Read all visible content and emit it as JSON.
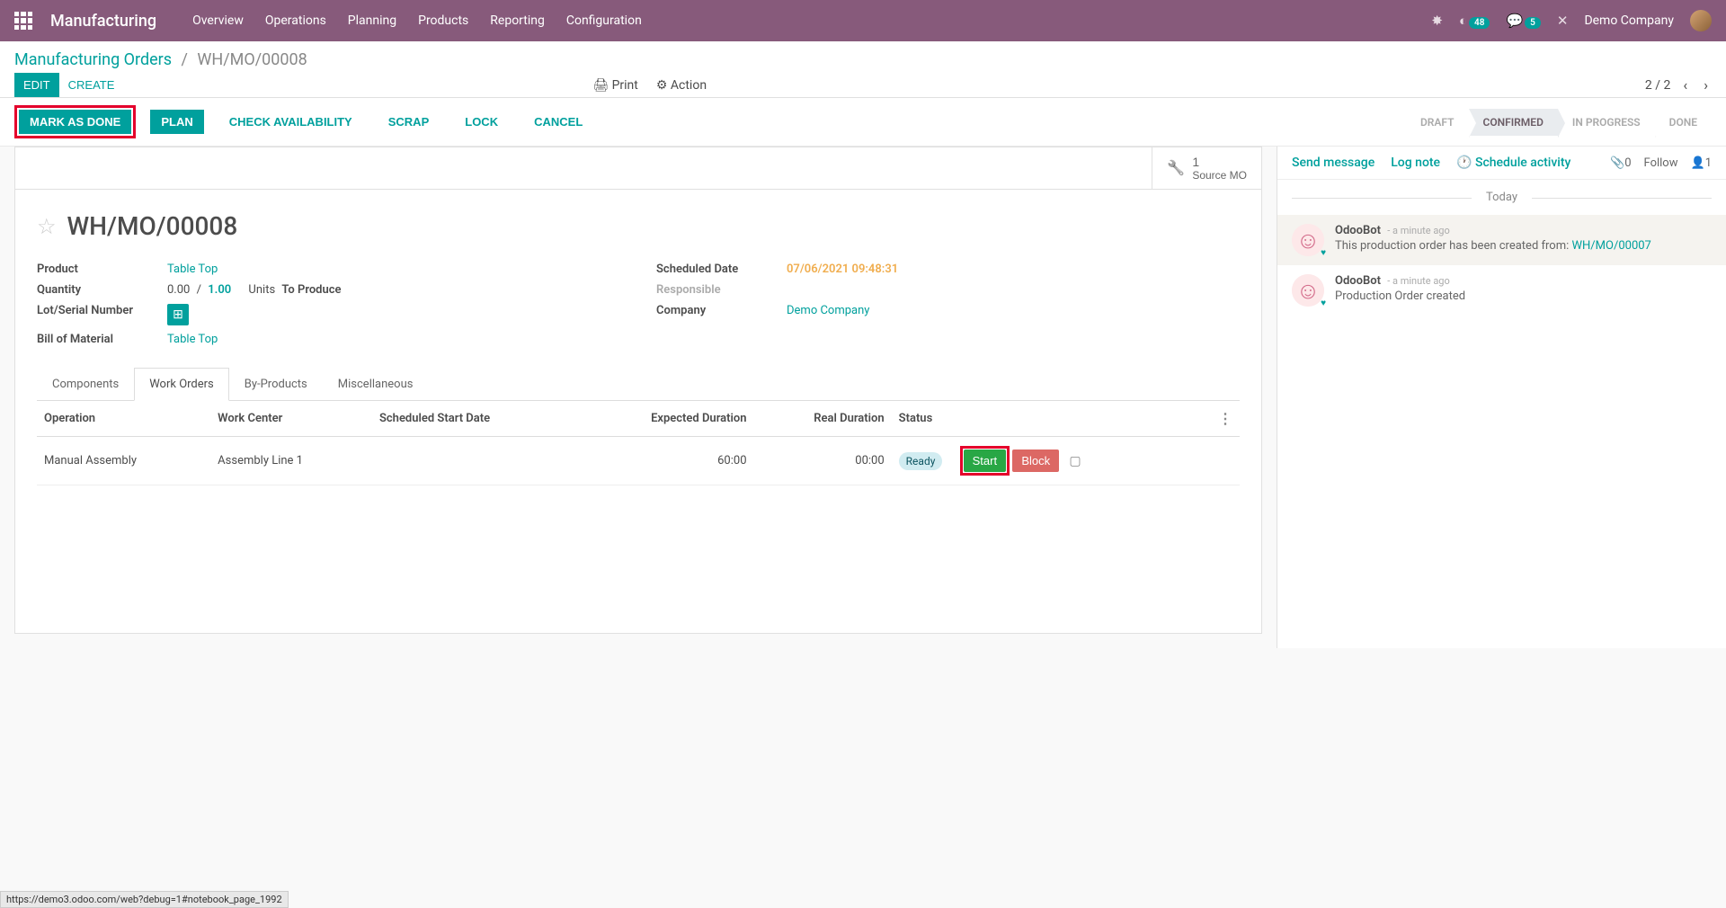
{
  "topnav": {
    "app_title": "Manufacturing",
    "menu": [
      "Overview",
      "Operations",
      "Planning",
      "Products",
      "Reporting",
      "Configuration"
    ],
    "badge1": "48",
    "badge2": "5",
    "company": "Demo Company"
  },
  "breadcrumb": {
    "root": "Manufacturing Orders",
    "current": "WH/MO/00008"
  },
  "head_buttons": {
    "edit": "EDIT",
    "create": "CREATE"
  },
  "head_actions": {
    "print": "Print",
    "action": "Action"
  },
  "pager": {
    "text": "2 / 2"
  },
  "action_buttons": {
    "mark_done": "MARK AS DONE",
    "plan": "PLAN",
    "check_avail": "CHECK AVAILABILITY",
    "scrap": "SCRAP",
    "lock": "LOCK",
    "cancel": "CANCEL"
  },
  "status_steps": [
    "DRAFT",
    "CONFIRMED",
    "IN PROGRESS",
    "DONE"
  ],
  "active_status": "CONFIRMED",
  "stat_button": {
    "count": "1",
    "label": "Source MO"
  },
  "record": {
    "name": "WH/MO/00008",
    "product_label": "Product",
    "product": "Table Top",
    "quantity_label": "Quantity",
    "qty_done": "0.00",
    "qty_sep": "/",
    "qty_total": "1.00",
    "uom": "Units",
    "to_produce": "To Produce",
    "lot_label": "Lot/Serial Number",
    "bom_label": "Bill of Material",
    "bom": "Table Top",
    "sched_label": "Scheduled Date",
    "sched_date": "07/06/2021 09:48:31",
    "resp_label": "Responsible",
    "company_label": "Company",
    "company": "Demo Company"
  },
  "tabs": [
    "Components",
    "Work Orders",
    "By-Products",
    "Miscellaneous"
  ],
  "active_tab": "Work Orders",
  "table": {
    "headers": {
      "operation": "Operation",
      "work_center": "Work Center",
      "sched_start": "Scheduled Start Date",
      "expected": "Expected Duration",
      "real": "Real Duration",
      "status": "Status"
    },
    "rows": [
      {
        "operation": "Manual Assembly",
        "work_center": "Assembly Line 1",
        "sched_start": "",
        "expected": "60:00",
        "real": "00:00",
        "status": "Ready",
        "start": "Start",
        "block": "Block"
      }
    ]
  },
  "chatter": {
    "send": "Send message",
    "log": "Log note",
    "schedule": "Schedule activity",
    "attach_count": "0",
    "follow": "Follow",
    "follower_count": "1",
    "today": "Today",
    "messages": [
      {
        "author": "OdooBot",
        "time": "- a minute ago",
        "text_prefix": "This production order has been created from: ",
        "link": "WH/MO/00007",
        "note": true
      },
      {
        "author": "OdooBot",
        "time": "- a minute ago",
        "text": "Production Order created",
        "note": false
      }
    ]
  },
  "browser_status": "https://demo3.odoo.com/web?debug=1#notebook_page_1992"
}
